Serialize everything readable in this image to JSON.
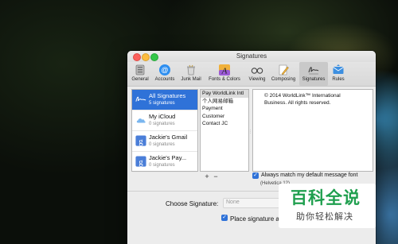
{
  "window": {
    "title": "Signatures"
  },
  "toolbar": {
    "items": [
      {
        "label": "General",
        "icon": "general-icon"
      },
      {
        "label": "Accounts",
        "icon": "at-sign-icon"
      },
      {
        "label": "Junk Mail",
        "icon": "junk-mail-icon"
      },
      {
        "label": "Fonts & Colors",
        "icon": "fonts-colors-icon"
      },
      {
        "label": "Viewing",
        "icon": "glasses-icon"
      },
      {
        "label": "Composing",
        "icon": "pencil-icon"
      },
      {
        "label": "Signatures",
        "icon": "signature-icon"
      },
      {
        "label": "Rules",
        "icon": "rules-icon"
      }
    ],
    "active": "Signatures"
  },
  "accounts": [
    {
      "name": "All Signatures",
      "count": "5 signatures",
      "icon": "signature-icon",
      "selected": true
    },
    {
      "name": "My iCloud",
      "count": "0 signatures",
      "icon": "icloud-icon",
      "selected": false
    },
    {
      "name": "Jackie's Gmail",
      "count": "0 signatures",
      "icon": "google-icon",
      "selected": false
    },
    {
      "name": "Jackie's Pay...",
      "count": "0 signatures",
      "icon": "google-icon",
      "selected": false
    }
  ],
  "signatures": [
    "Pay WorldLink Intl",
    "个人网易邮箱",
    "Payment",
    "Customer",
    "Contact JC"
  ],
  "preview": {
    "line1": "© 2014 WorldLink™ International",
    "line2": "Business. All rights reserved."
  },
  "controls": {
    "add": "+",
    "remove": "−",
    "always_match_label": "Always match my default message font",
    "font_note": "(Helvetica 12)",
    "choose_signature_label": "Choose Signature:",
    "choose_signature_value": "None",
    "place_signature_label": "Place signature above quoted text"
  },
  "watermark": {
    "title": "百科全说",
    "subtitle": "助你轻松解决"
  },
  "colors": {
    "selection": "#2f72d8",
    "watermark_green": "#1f9f4e"
  }
}
